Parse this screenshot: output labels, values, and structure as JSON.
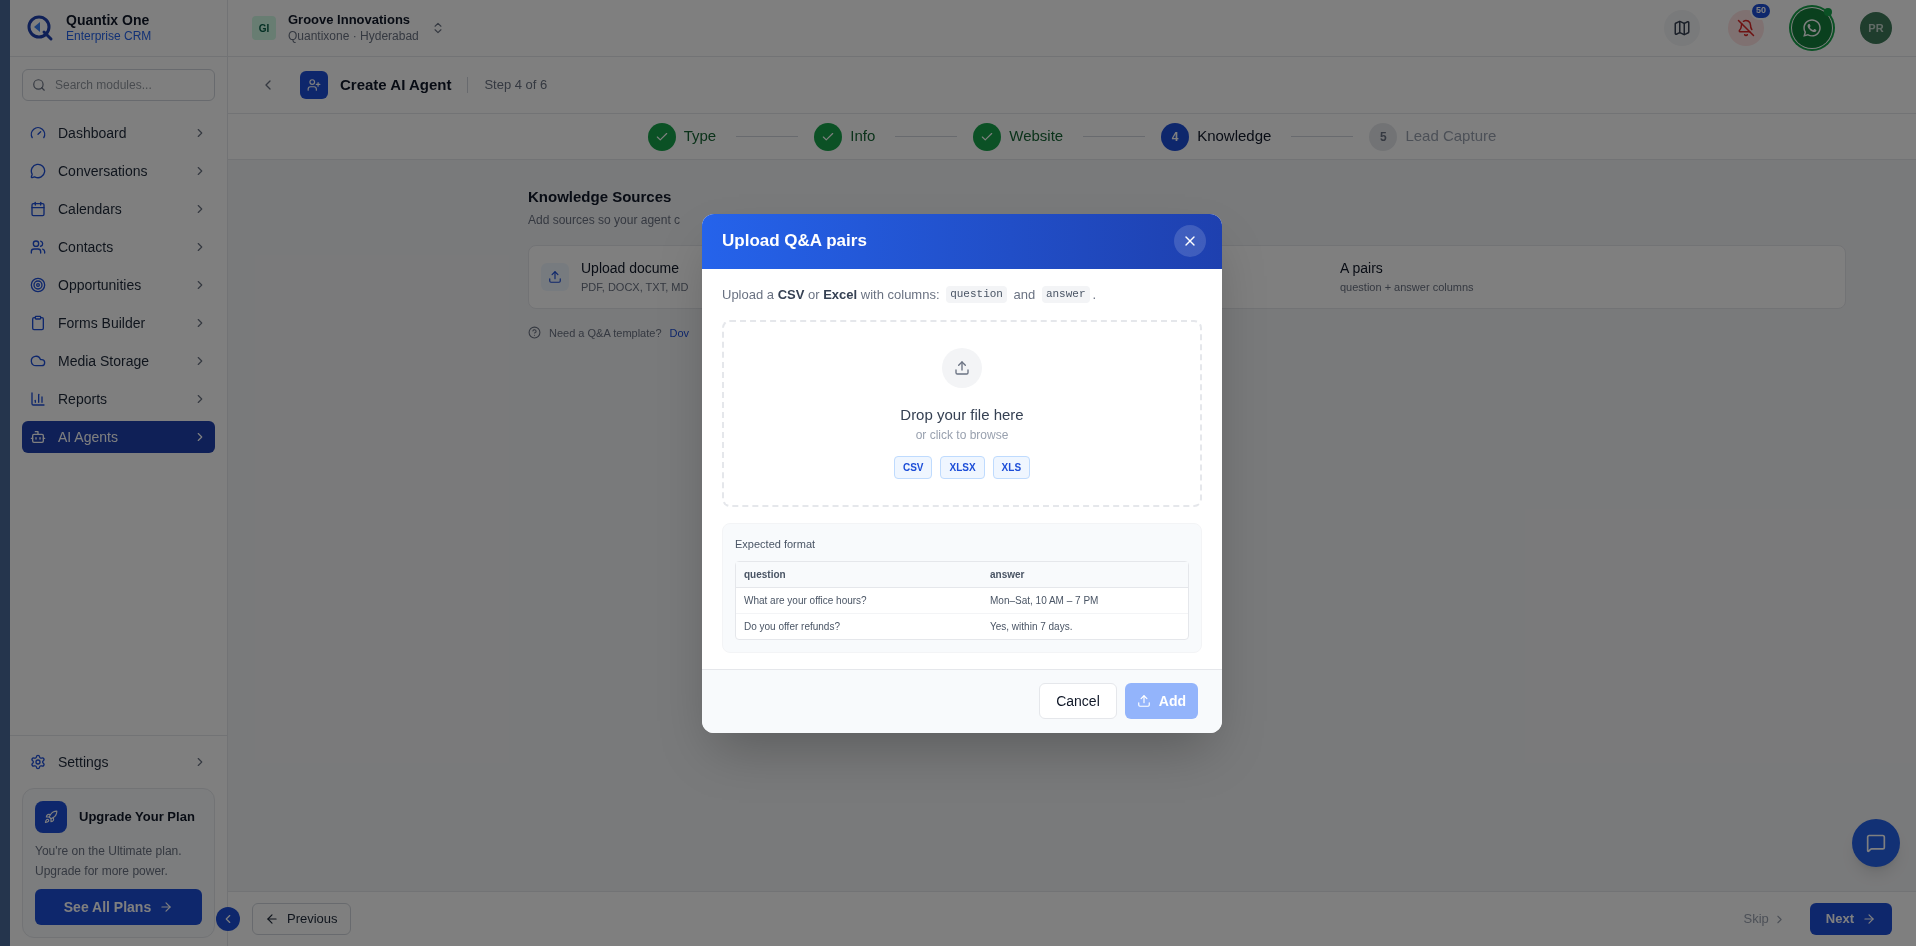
{
  "brand": {
    "name": "Quantix One",
    "subtitle": "Enterprise CRM"
  },
  "sidebar": {
    "search": {
      "placeholder": "Search modules..."
    },
    "items": [
      {
        "label": "Dashboard",
        "selected": false
      },
      {
        "label": "Conversations",
        "selected": false
      },
      {
        "label": "Calendars",
        "selected": false
      },
      {
        "label": "Contacts",
        "selected": false
      },
      {
        "label": "Opportunities",
        "selected": false
      },
      {
        "label": "Forms Builder",
        "selected": false
      },
      {
        "label": "Media Storage",
        "selected": false
      },
      {
        "label": "Reports",
        "selected": false
      },
      {
        "label": "AI Agents",
        "selected": true
      }
    ],
    "settings": {
      "label": "Settings"
    },
    "upgrade": {
      "title": "Upgrade Your Plan",
      "text": "You're on the Ultimate plan. Upgrade for more power.",
      "button": "See All Plans"
    }
  },
  "header": {
    "org": {
      "initials": "GI",
      "name": "Groove Innovations",
      "location": "Quantixone · Hyderabad"
    },
    "notifications": "50",
    "whatsapp_online": true,
    "avatar": "PR"
  },
  "page": {
    "title": "Create AI Agent",
    "step": "Step 4 of 6"
  },
  "stepper": [
    {
      "label": "Type",
      "kind": "done"
    },
    {
      "label": "Info",
      "kind": "done"
    },
    {
      "label": "Website",
      "kind": "done"
    },
    {
      "label": "Knowledge",
      "kind": "current",
      "number": "4"
    },
    {
      "label": "Lead Capture",
      "kind": "upcoming",
      "number": "5"
    }
  ],
  "knowledge": {
    "title": "Knowledge Sources",
    "subtitle": "Add sources so your agent c",
    "cards": [
      {
        "title": "Upload docume",
        "text": "PDF, DOCX, TXT, MD"
      },
      {
        "title": "A pairs",
        "text": "question + answer columns"
      }
    ],
    "hint": "Need a Q&A template?",
    "hint_link": "Dov"
  },
  "modal": {
    "title": "Upload Q&A pairs",
    "description": [
      {
        "kind": "text",
        "text": "Upload a **CSV** or **Excel** with columns: "
      },
      {
        "kind": "code",
        "text": "question"
      },
      {
        "kind": "text",
        "text": " and "
      },
      {
        "kind": "code",
        "text": "answer"
      },
      {
        "kind": "text",
        "text": "."
      }
    ],
    "dropzone": {
      "title": "Drop your file here",
      "subtitle": "or click to browse",
      "formats": [
        "CSV",
        "XLSX",
        "XLS"
      ]
    },
    "format": {
      "title": "Expected format",
      "columns": [
        "question",
        "answer"
      ],
      "rows": [
        [
          "What are your office hours?",
          "Mon–Sat, 10 AM – 7 PM"
        ],
        [
          "Do you offer refunds?",
          "Yes, within 7 days."
        ]
      ]
    },
    "cancel": "Cancel",
    "add": {
      "label": "Add",
      "disabled": true
    }
  },
  "footer": {
    "previous": "Previous",
    "skip": "Skip",
    "next": "Next"
  }
}
